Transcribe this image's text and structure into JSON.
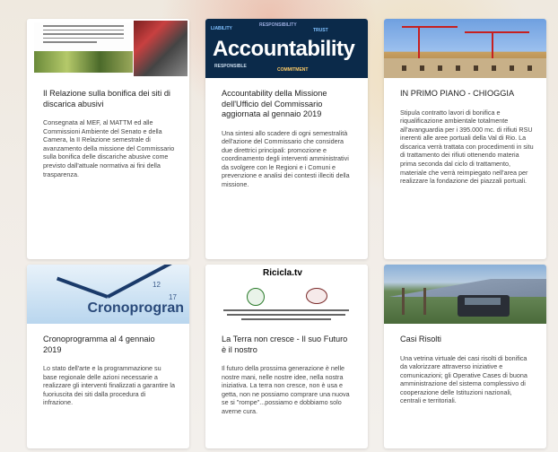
{
  "cards": [
    {
      "title": "Il Relazione sulla bonifica dei siti di discarica abusivi",
      "description": "Consegnata al MEF, al MATTM ed alle Commissioni Ambiente del Senato e della Camera, la II Relazione semestrale di avanzamento della missione del Commissario sulla bonifica delle discariche abusive come previsto dall'attuale normativa ai fini della trasparenza."
    },
    {
      "title": "Accountability della Missione dell'Ufficio del Commissario aggiornata al gennaio 2019",
      "description": "Una sintesi allo scadere di ogni semestralità dell'azione del Commissario che considera due direttrici principali: promozione e coordinamento degli interventi amministrativi da svolgere con le Regioni e i Comuni e prevenzione e analisi dei contesti illeciti della missione.",
      "thumb_text": "Accountability"
    },
    {
      "title": "IN PRIMO PIANO - CHIOGGIA",
      "description": "Stipula contratto lavori di bonifica e riqualificazione ambientale totalmente all'avanguardia per i 395.000 mc. di rifiuti RSU inerenti alle aree portuali della Val di Rio. La discarica verrà trattata con procedimenti in situ di trattamento dei rifiuti ottenendo materia prima seconda dal ciclo di trattamento, materiale che verrà reimpiegato nell'area per realizzare la fondazione dei piazzali portuali."
    },
    {
      "title": "Cronoprogramma al 4 gennaio 2019",
      "description": "Lo stato dell'arte e la programmazione su base regionale delle azioni necessarie a realizzare gli interventi finalizzati a garantire la fuoriuscita dei siti dalla procedura di infrazione.",
      "thumb_text": "Cronoprogran"
    },
    {
      "title": "La Terra non cresce - Il suo Futuro è il nostro",
      "description": "Il futuro della prossima generazione è nelle nostre mani, nelle nostre idee, nella nostra iniziativa. La terra non cresce, non è usa e getta, non ne possiamo comprare una nuova se si \"rompe\"...possiamo e dobbiamo solo averne cura.",
      "thumb_text": "Ricicla.tv"
    },
    {
      "title": "Casi Risolti",
      "description": "Una vetrina virtuale dei casi risolti di bonifica da valorizzare attraverso iniziative e comunicazioni; gli Operative Cases di buona amministrazione del sistema complessivo di cooperazione delle Istituzioni nazionali, centrali e territoriali."
    }
  ]
}
